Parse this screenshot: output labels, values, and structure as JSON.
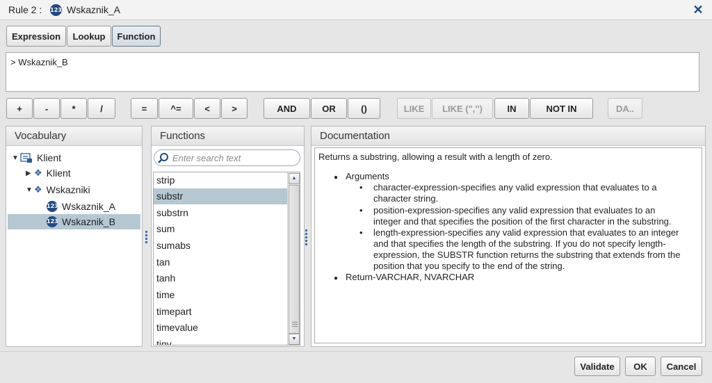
{
  "title": {
    "prefix": "Rule 2 :",
    "badge": "123",
    "name": "Wskaznik_A",
    "close": "✕"
  },
  "tabs": [
    "Expression",
    "Lookup",
    "Function"
  ],
  "expression": "> Wskaznik_B",
  "operators": [
    "+",
    "-",
    "*",
    "/",
    "=",
    "^=",
    "<",
    ">",
    "AND",
    "OR",
    "()",
    "LIKE",
    "LIKE (\",\")",
    "IN",
    "NOT IN",
    "DA.."
  ],
  "vocabulary": {
    "header": "Vocabulary",
    "root": "Klient",
    "child1": "Klient",
    "child2": "Wskazniki",
    "leaf1": "Wskaznik_A",
    "leaf2": "Wskaznik_B",
    "badge": "123"
  },
  "functions": {
    "header": "Functions",
    "search_placeholder": "Enter search text",
    "items": [
      "strip",
      "substr",
      "substrn",
      "sum",
      "sumabs",
      "tan",
      "tanh",
      "time",
      "timepart",
      "timevalue",
      "tinv"
    ]
  },
  "documentation": {
    "header": "Documentation",
    "intro": "Returns a substring, allowing a result with a length of zero.",
    "arguments_label": "Arguments",
    "args": [
      [
        "character-expression-specifies any valid expression that evaluates to a",
        "character string."
      ],
      [
        "position-expression-specifies any valid expression that evaluates to an",
        "integer and that specifies the position of the first character in the substring."
      ],
      [
        "length-expression-specifies any valid expression that evaluates to an integer",
        "and that specifies the length of the substring. If you do not specify length-",
        "expression, the SUBSTR function returns the substring that extends from the",
        "position that you specify to the end of the string."
      ]
    ],
    "return": "Return-VARCHAR, NVARCHAR"
  },
  "footer": {
    "validate": "Validate",
    "ok": "OK",
    "cancel": "Cancel"
  }
}
